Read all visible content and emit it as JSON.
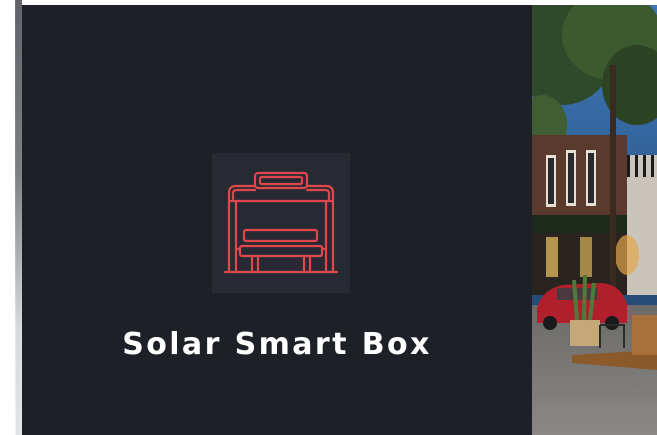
{
  "card": {
    "title": "Solar Smart Box",
    "icon": "bus-shelter-bench-icon",
    "icon_color": "#e0474c",
    "background": "#1e2028"
  },
  "photo": {
    "description_icon": "street-scene-photo"
  }
}
